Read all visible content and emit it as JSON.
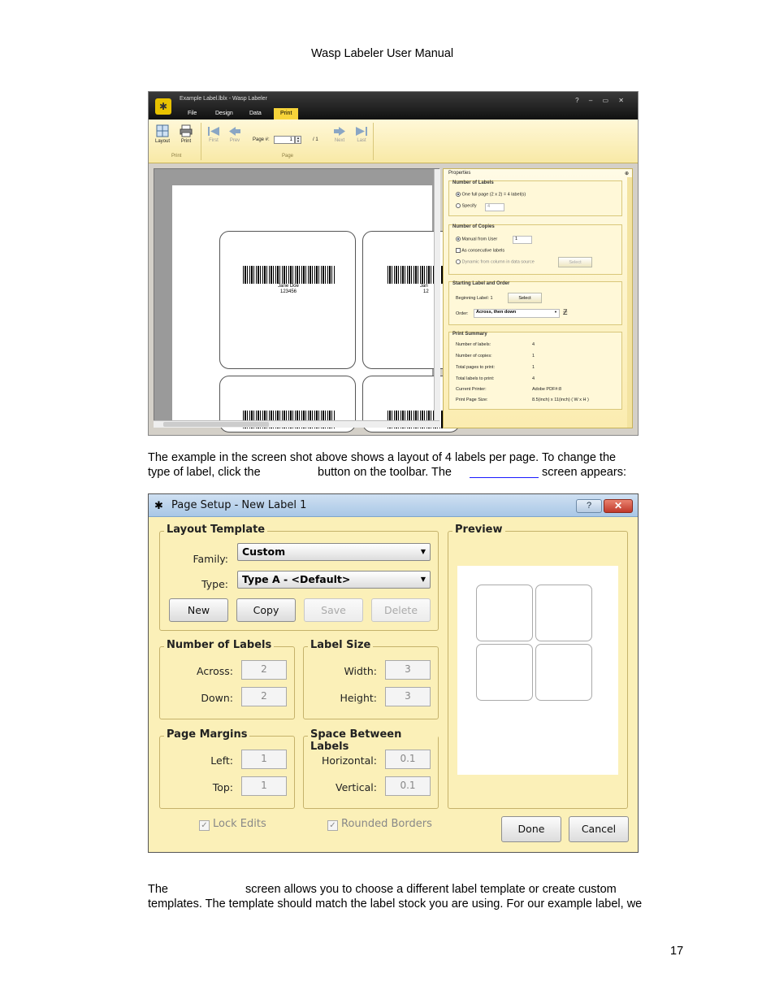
{
  "header": {
    "title": "Wasp Labeler User Manual"
  },
  "screenshot1": {
    "window_title": "Example Label.lblx - Wasp Labeler",
    "tabs": [
      "File",
      "Design",
      "Data",
      "Print"
    ],
    "ribbon": {
      "layout": "Layout",
      "print": "Print",
      "group_print": "Print",
      "first": "First",
      "prev": "Prev",
      "page_label": "Page #:",
      "page_value": "1",
      "page_of": "/ 1",
      "next": "Next",
      "last": "Last",
      "group_page": "Page"
    },
    "labels": [
      {
        "name": "Jane Doe",
        "number": "123456"
      },
      {
        "name": "Jan",
        "number": "12"
      }
    ],
    "properties": {
      "title": "Properties",
      "num_labels_title": "Number of Labels",
      "full_page": "One full page (2 x 2) = 4 label(s)",
      "specify": "Specify",
      "specify_value": "4",
      "num_copies_title": "Number of Copies",
      "manual": "Manual from User",
      "manual_value": "1",
      "consecutive": "As consecutive labels",
      "dynamic": "Dynamic from column in data source",
      "select": "Select",
      "starting_title": "Starting Label and Order",
      "beginning": "Beginning Label: 1",
      "select2": "Select",
      "order_label": "Order:",
      "order_value": "Across, then down",
      "summary_title": "Print Summary",
      "summary": [
        {
          "k": "Number of labels:",
          "v": "4"
        },
        {
          "k": "Number of copies:",
          "v": "1"
        },
        {
          "k": "Total pages to print:",
          "v": "1"
        },
        {
          "k": "Total labels to print:",
          "v": "4"
        },
        {
          "k": "Current Printer:",
          "v": "Adobe PDF#:8"
        },
        {
          "k": "Print Page Size:",
          "v": "8.5(inch) x 11(inch) ( W x H )"
        }
      ]
    }
  },
  "para1": {
    "line1": "The example in the screen shot above shows a layout of 4 labels per page.  To change the",
    "line2a": "type of label, click the",
    "line2b": "button on the toolbar.  The",
    "line2c": "screen appears:"
  },
  "screenshot2": {
    "window_title": "Page Setup - New Label 1",
    "help": "?",
    "close": "✕",
    "layout_template": "Layout Template",
    "family_label": "Family:",
    "family_value": "Custom",
    "type_label": "Type:",
    "type_value": "Type A - <Default>",
    "btn_new": "New",
    "btn_copy": "Copy",
    "btn_save": "Save",
    "btn_delete": "Delete",
    "num_labels": "Number of Labels",
    "across_label": "Across:",
    "across_value": "2",
    "down_label": "Down:",
    "down_value": "2",
    "label_size": "Label Size",
    "width_label": "Width:",
    "width_value": "3",
    "height_label": "Height:",
    "height_value": "3",
    "page_margins": "Page Margins",
    "left_label": "Left:",
    "left_value": "1",
    "top_label": "Top:",
    "top_value": "1",
    "space_between": "Space Between Labels",
    "horizontal_label": "Horizontal:",
    "horizontal_value": "0.1",
    "vertical_label": "Vertical:",
    "vertical_value": "0.1",
    "preview": "Preview",
    "lock_edits": "Lock Edits",
    "rounded_borders": "Rounded Borders",
    "done": "Done",
    "cancel": "Cancel"
  },
  "para2": {
    "line1a": "The",
    "line1b": "screen allows you to choose a different label template or create custom",
    "line2": "templates.  The template should match the label stock you are using. For our example label, we"
  },
  "page_number": "17",
  "colors": {
    "ribbon": "#f8e9a6",
    "print_tab": "#f7d43a",
    "dialog_bg": "#fbf0b8",
    "link": "#1a1aff"
  }
}
